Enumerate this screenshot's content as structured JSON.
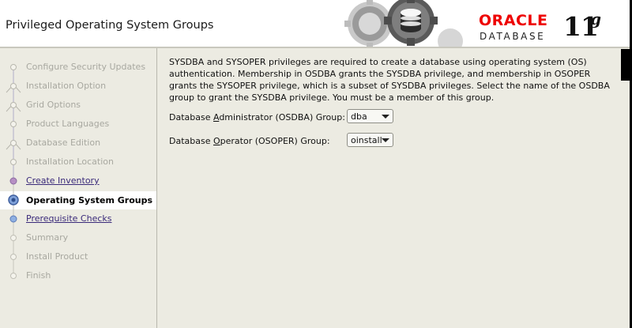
{
  "header": {
    "title": "Privileged Operating System Groups",
    "logo": {
      "brand": "ORACLE",
      "registered": "®",
      "product": "DATABASE",
      "version": "11",
      "version_suffix": "g"
    }
  },
  "sidebar": {
    "steps": [
      {
        "label": "Configure Security Updates",
        "state": "done"
      },
      {
        "label": "Installation Option",
        "state": "done"
      },
      {
        "label": "Grid Options",
        "state": "done"
      },
      {
        "label": "Product Languages",
        "state": "done"
      },
      {
        "label": "Database Edition",
        "state": "done"
      },
      {
        "label": "Installation Location",
        "state": "done"
      },
      {
        "label": "Create Inventory",
        "state": "link"
      },
      {
        "label": "Operating System Groups",
        "state": "current"
      },
      {
        "label": "Prerequisite Checks",
        "state": "link"
      },
      {
        "label": "Summary",
        "state": "pending"
      },
      {
        "label": "Install Product",
        "state": "pending"
      },
      {
        "label": "Finish",
        "state": "pending"
      }
    ]
  },
  "main": {
    "description": "SYSDBA and SYSOPER privileges are required to create a database using operating system (OS) authentication. Membership in OSDBA grants the SYSDBA privilege, and membership in OSOPER grants the SYSOPER privilege, which is a subset of SYSDBA privileges. Select the name of the OSDBA group to grant the SYSDBA privilege. You must be a member of this group.",
    "osdba": {
      "label_pre": "Database ",
      "label_key": "A",
      "label_post": "dministrator (OSDBA) Group:",
      "value": "dba"
    },
    "osoper": {
      "label_pre": "Database ",
      "label_key": "O",
      "label_post": "perator (OSOPER) Group:",
      "value": "oinstall"
    }
  },
  "colors": {
    "accent_red": "#e00000",
    "link": "#3a2a7a",
    "sidebar_bg": "#ecebe2"
  }
}
